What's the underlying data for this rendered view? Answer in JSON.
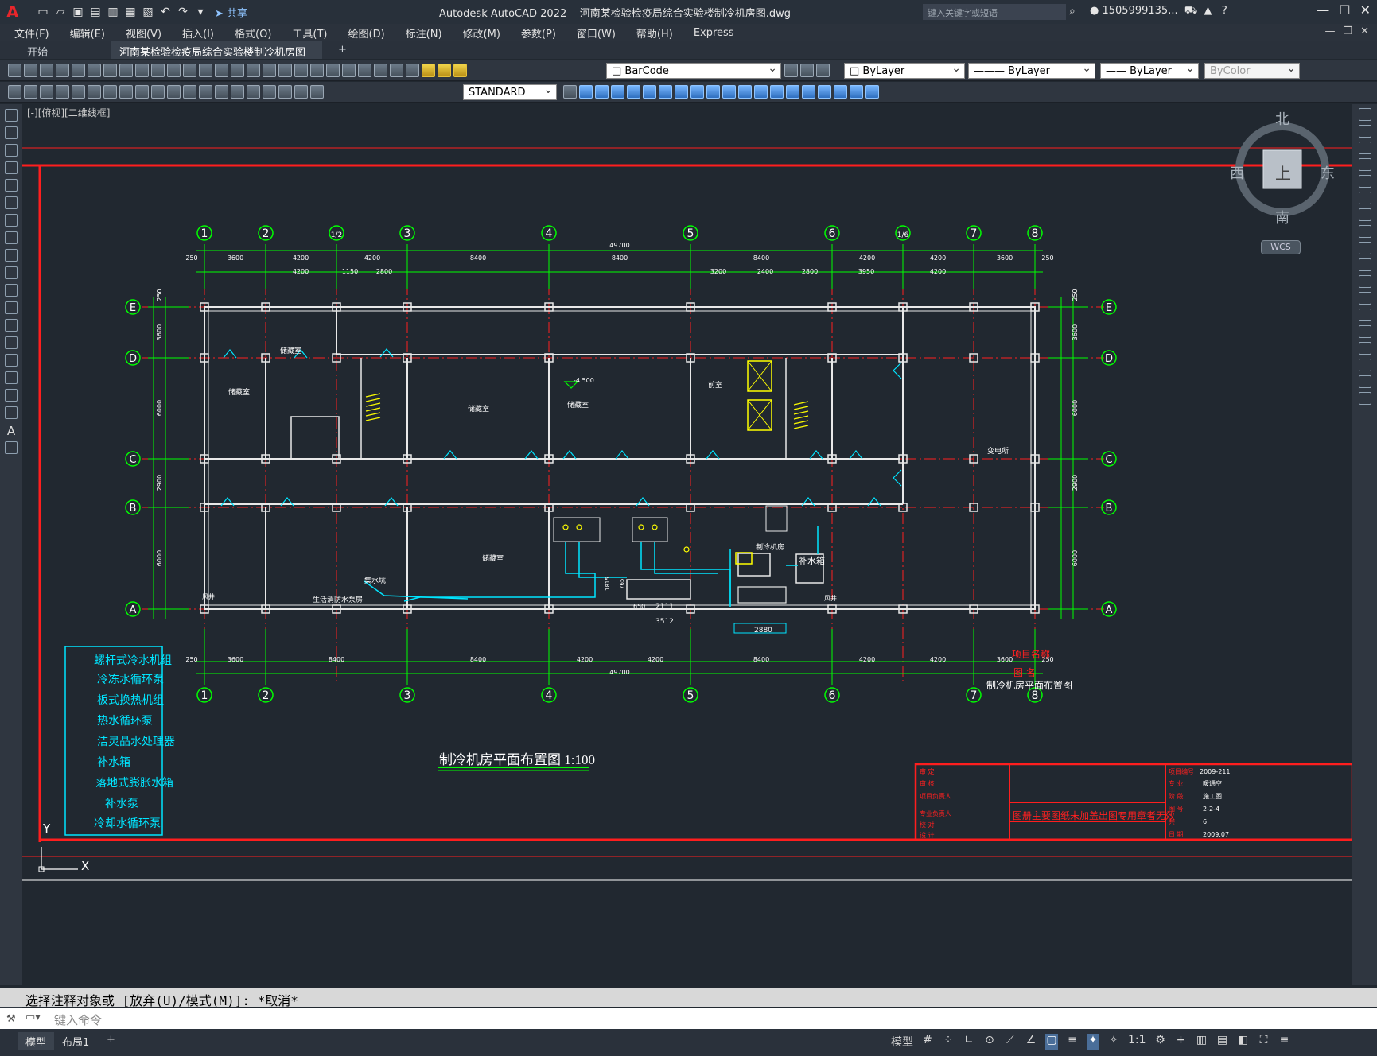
{
  "app": {
    "title": "Autodesk AutoCAD 2022",
    "filename": "河南某检验检疫局综合实验楼制冷机房图.dwg",
    "share_label": "共享",
    "search_placeholder": "键入关键字或短语",
    "user_name": "1505999135..."
  },
  "menu": [
    "文件(F)",
    "编辑(E)",
    "视图(V)",
    "插入(I)",
    "格式(O)",
    "工具(T)",
    "绘图(D)",
    "标注(N)",
    "修改(M)",
    "参数(P)",
    "窗口(W)",
    "帮助(H)",
    "Express"
  ],
  "tabs": {
    "start": "开始",
    "drawing": "河南某检验检疫局综合实验楼制冷机房图*"
  },
  "toolbar": {
    "layer_name": "BarCode",
    "textstyle": "STANDARD",
    "color": "ByLayer",
    "linetype": "ByLayer",
    "lineweight": "ByLayer",
    "plotstyle": "ByColor"
  },
  "viewport": {
    "label": "[-][俯视][二维线框]"
  },
  "compass": {
    "north": "北",
    "south": "南",
    "east": "东",
    "west": "西",
    "top": "上",
    "wcs": "WCS"
  },
  "drawing": {
    "grid_top": [
      "1",
      "2",
      "1/2",
      "3",
      "4",
      "5",
      "6",
      "1/6",
      "7",
      "8"
    ],
    "grid_bottom": [
      "1",
      "2",
      "3",
      "4",
      "5",
      "6",
      "7",
      "8"
    ],
    "grid_rows": [
      "E",
      "D",
      "C",
      "B",
      "A"
    ],
    "dim_total": "49700",
    "dims_top_row1": [
      "250",
      "3600",
      "4200",
      "4200",
      "8400",
      "8400",
      "8400",
      "4200",
      "4200",
      "3600",
      "250"
    ],
    "dims_top_row2": [
      "4200",
      "1150",
      "2800",
      "3200",
      "2400",
      "2800",
      "3950",
      "4200"
    ],
    "dims_bottom": [
      "250",
      "3600",
      "8400",
      "8400",
      "4200",
      "4200",
      "8400",
      "4200",
      "4200",
      "3600",
      "250"
    ],
    "dims_left": [
      "250",
      "3600",
      "6000",
      "2900",
      "6000"
    ],
    "rooms": [
      "储藏室",
      "储藏室",
      "储藏室",
      "储藏室",
      "前室",
      "储藏室",
      "变电所",
      "制冷机房",
      "集水坑",
      "生活消防水泵房",
      "补水箱",
      "风井",
      "风井"
    ],
    "elevation": "-4.500",
    "room_dims": [
      "3512",
      "2111",
      "650",
      "2880",
      "1815",
      "765"
    ],
    "plan_title": "制冷机房平面布置图 1:100",
    "legend": [
      "螺杆式冷水机组",
      "冷冻水循环泵",
      "板式换热机组",
      "热水循环泵",
      "洁灵晶水处理器",
      "补水箱",
      "落地式膨胀水箱",
      "补水泵",
      "冷却水循环泵"
    ],
    "titleblock": {
      "left_labels": [
        "审 定",
        "审 核",
        "项目负责人",
        "专业负责人",
        "校 对",
        "设 计"
      ],
      "project_label": "项目名称",
      "name_label": "图 名",
      "drawing_name": "制冷机房平面布置图",
      "right_labels": [
        "项目编号",
        "专 业",
        "阶 段",
        "图 号",
        "共",
        "日 期"
      ],
      "right_values": [
        "2009-211",
        "暖通空",
        "施工图",
        "2-2-4",
        "6",
        "2009.07"
      ],
      "warning": "图册主要图纸未加盖出图专用章者无效"
    },
    "ucs": {
      "x": "X",
      "y": "Y"
    }
  },
  "command": {
    "history": "选择注释对象或 [放弃(U)/模式(M)]: *取消*",
    "placeholder": "键入命令"
  },
  "status": {
    "model_tab": "模型",
    "layout_tab": "布局1",
    "model_btn": "模型",
    "scale": "1:1"
  },
  "colors": {
    "red": "#ff2020",
    "green": "#00ff00",
    "cyan": "#00e5ff",
    "yellow": "#ffff00",
    "white": "#ffffff"
  }
}
